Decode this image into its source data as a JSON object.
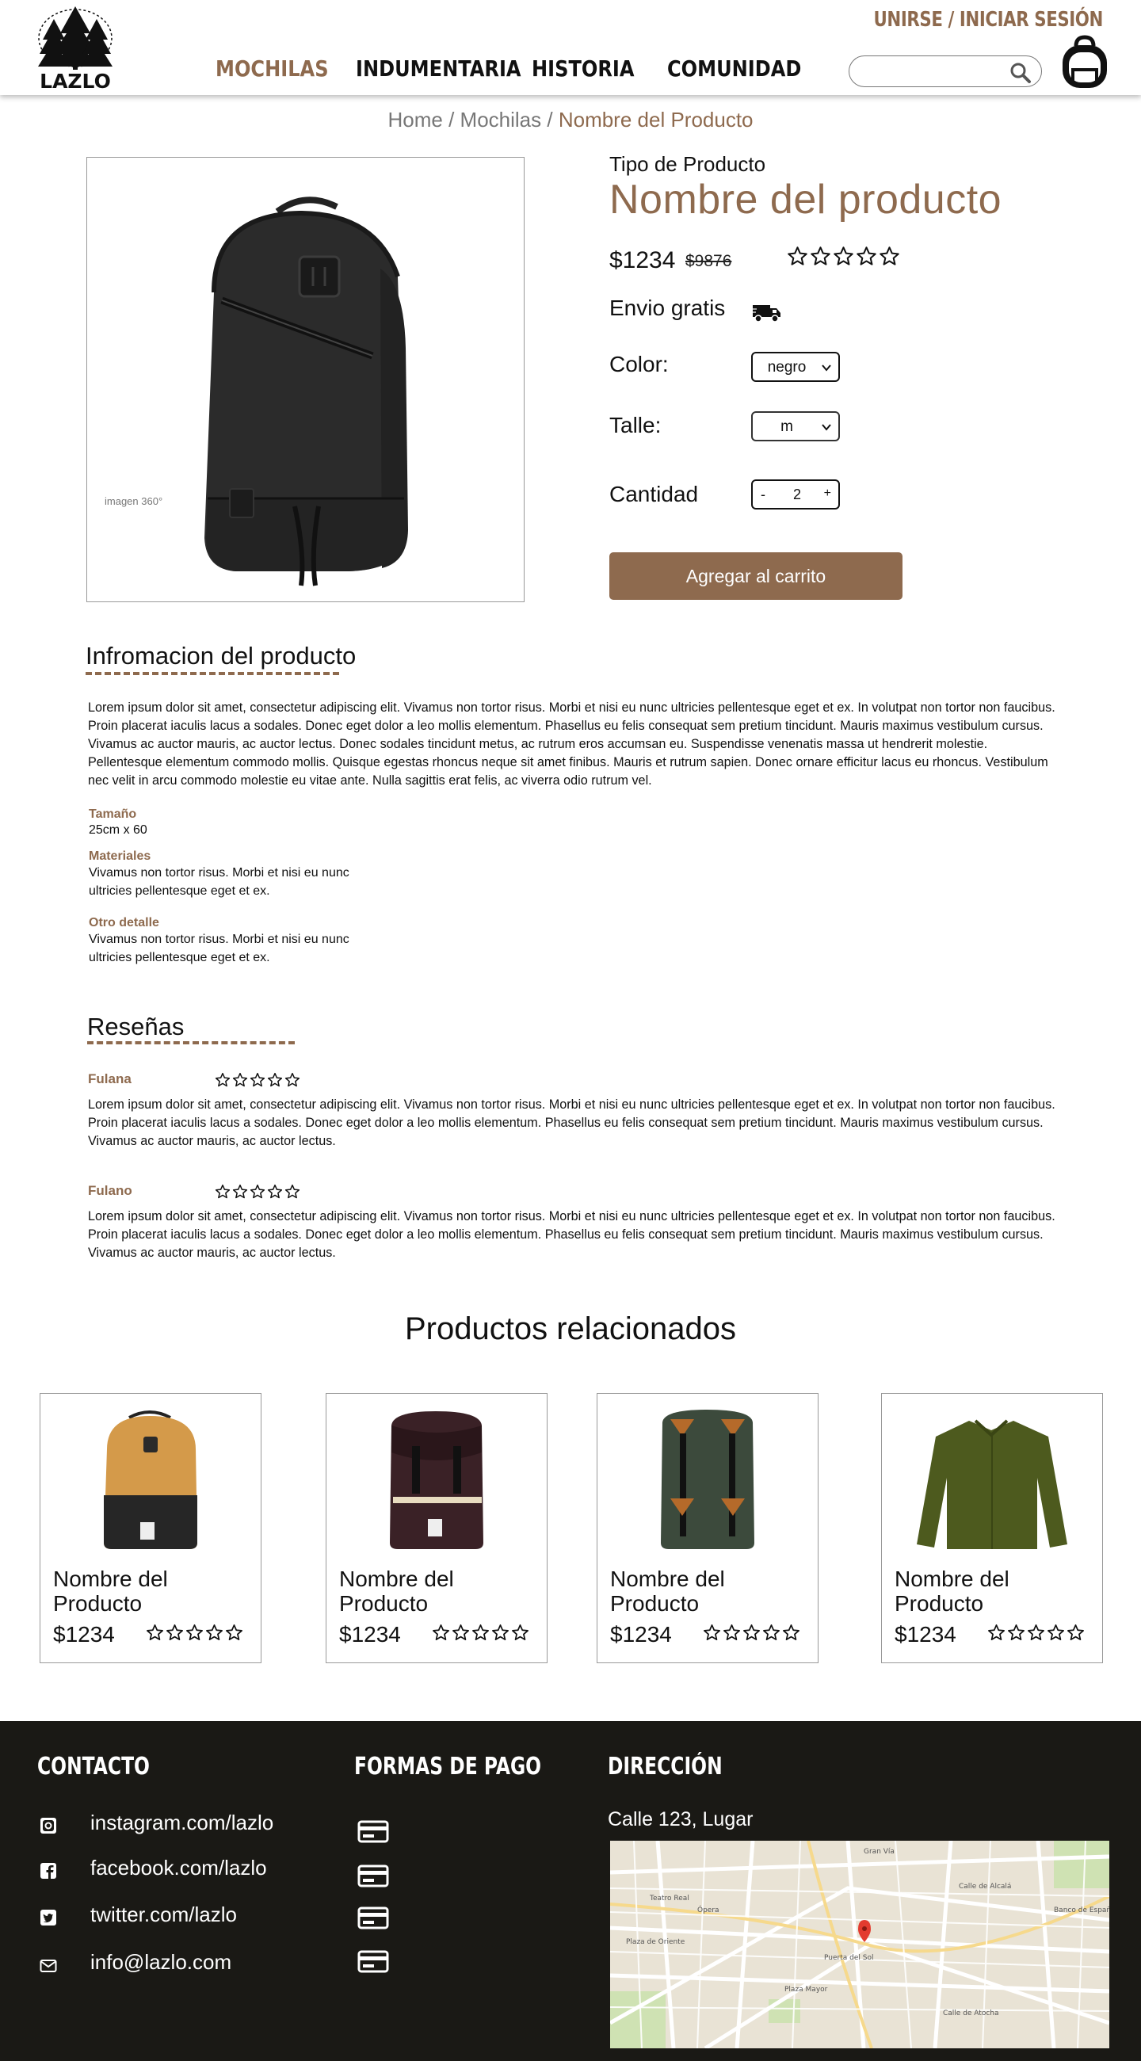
{
  "header": {
    "brand": "LAZLO",
    "login": "UNIRSE / INICIAR SESIÓN",
    "nav": [
      "MOCHILAS",
      "INDUMENTARIA",
      "HISTORIA",
      "COMUNIDAD"
    ],
    "search_placeholder": "",
    "accent_color": "#8e6a4e"
  },
  "breadcrumb": {
    "home": "Home",
    "section": "Mochilas",
    "current": "Nombre del Producto",
    "separator": "/"
  },
  "product": {
    "image_caption": "imagen 360°",
    "type": "Tipo de Producto",
    "name": "Nombre del producto",
    "price": "$1234",
    "old_price": "$9876",
    "rating": 0,
    "shipping": "Envio gratis",
    "color_label": "Color:",
    "color_value": "negro",
    "size_label": "Talle:",
    "size_value": "m",
    "qty_label": "Cantidad",
    "qty_minus": "-",
    "qty_value": "2",
    "qty_plus": "+",
    "add_to_cart": "Agregar al carrito"
  },
  "info": {
    "title": "Infromacion del producto",
    "description": "Lorem ipsum dolor sit amet, consectetur adipiscing elit. Vivamus non tortor risus. Morbi et nisi eu nunc ultricies pellentesque eget et ex. In volutpat non tortor non faucibus. Proin placerat iaculis lacus a sodales. Donec eget dolor a leo mollis elementum. Phasellus eu felis consequat sem pretium tincidunt. Mauris maximus vestibulum cursus. Vivamus ac auctor mauris, ac auctor lectus. Donec sodales tincidunt metus, ac rutrum eros accumsan eu. Suspendisse venenatis massa ut hendrerit molestie. Pellentesque elementum commodo mollis. Quisque egestas rhoncus neque sit amet finibus. Mauris et rutrum sapien. Donec ornare efficitur lacus eu rhoncus. Vestibulum nec velit in arcu commodo molestie eu vitae ante. Nulla sagittis erat felis, ac viverra odio rutrum vel.",
    "size_label": "Tamaño",
    "size_value": "25cm x 60",
    "materials_label": "Materiales",
    "materials_value": " Vivamus non tortor risus. Morbi et nisi eu nunc ultricies pellentesque eget et ex.",
    "other_label": "Otro detalle",
    "other_value": " Vivamus non tortor risus. Morbi et nisi eu nunc ultricies pellentesque eget et ex."
  },
  "reviews": {
    "title": "Reseñas",
    "items": [
      {
        "author": "Fulana",
        "rating": 0,
        "text": "Lorem ipsum dolor sit amet, consectetur adipiscing elit. Vivamus non tortor risus. Morbi et nisi eu nunc ultricies pellentesque eget et ex. In volutpat non tortor non faucibus. Proin placerat iaculis lacus a sodales. Donec eget dolor a leo mollis elementum. Phasellus eu felis consequat sem pretium tincidunt. Mauris maximus vestibulum cursus. Vivamus ac auctor mauris, ac auctor lectus."
      },
      {
        "author": "Fulano",
        "rating": 0,
        "text": "Lorem ipsum dolor sit amet, consectetur adipiscing elit. Vivamus non tortor risus. Morbi et nisi eu nunc ultricies pellentesque eget et ex. In volutpat non tortor non faucibus. Proin placerat iaculis lacus a sodales. Donec eget dolor a leo mollis elementum. Phasellus eu felis consequat sem pretium tincidunt. Mauris maximus vestibulum cursus. Vivamus ac auctor mauris, ac auctor lectus."
      }
    ]
  },
  "related": {
    "title": "Productos relacionados",
    "items": [
      {
        "name": "Nombre del Producto",
        "price": "$1234",
        "rating": 0,
        "image": "tan-backpack",
        "color": "#d49a4a"
      },
      {
        "name": "Nombre del Producto",
        "price": "$1234",
        "rating": 0,
        "image": "dark-brown-rucksack",
        "color": "#3a2126"
      },
      {
        "name": "Nombre del Producto",
        "price": "$1234",
        "rating": 0,
        "image": "green-rucksack",
        "color": "#3c4a3c"
      },
      {
        "name": "Nombre del Producto",
        "price": "$1234",
        "rating": 0,
        "image": "olive-shirt",
        "color": "#4d5a1e"
      }
    ]
  },
  "footer": {
    "contact_title": "CONTACTO",
    "contacts": [
      {
        "icon": "instagram-icon",
        "text": "instagram.com/lazlo"
      },
      {
        "icon": "facebook-icon",
        "text": "facebook.com/lazlo"
      },
      {
        "icon": "twitter-icon",
        "text": "twitter.com/lazlo"
      },
      {
        "icon": "mail-icon",
        "text": "info@lazlo.com"
      }
    ],
    "payment_title": "FORMAS DE PAGO",
    "payment_icons": [
      "credit-card-icon",
      "credit-card-icon",
      "credit-card-icon",
      "credit-card-icon"
    ],
    "address_title": "DIRECCIÓN",
    "address": "Calle 123, Lugar",
    "map_labels": [
      "Puerta del Sol",
      "Plaza Mayor",
      "Gran Vía",
      "Ópera",
      "Teatro Real",
      "Banco de España",
      "Calle de Atocha",
      "Plaza de Oriente",
      "Calle de Alcalá"
    ]
  }
}
